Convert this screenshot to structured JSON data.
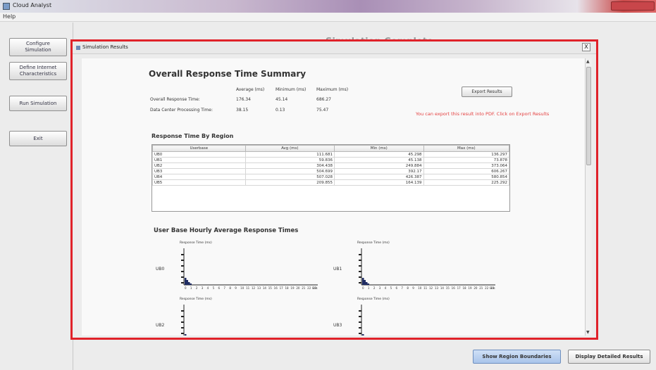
{
  "window": {
    "title": "Cloud Analyst"
  },
  "menu": {
    "help": "Help"
  },
  "nav": {
    "configure": "Configure\nSimulation",
    "internet": "Define Internet\nCharacteristics",
    "run": "Run Simulation",
    "exit": "Exit"
  },
  "main": {
    "title": "Simulation Complete"
  },
  "dialog": {
    "title": "Simulation Results",
    "close": "X",
    "overall": {
      "heading": "Overall Response Time Summary",
      "headers": {
        "avg": "Average (ms)",
        "min": "Minimum (ms)",
        "max": "Maximum (ms)"
      },
      "rows": [
        {
          "label": "Overall Response Time:",
          "avg": "176.34",
          "min": "45.14",
          "max": "686.27"
        },
        {
          "label": "Data Center Processing Time:",
          "avg": "38.15",
          "min": "0.13",
          "max": "75.47"
        }
      ]
    },
    "export_button": "Export Results",
    "export_note": "You can export this result into PDF. Click on Export Results",
    "region": {
      "heading": "Response Time By Region",
      "columns": [
        "Userbase",
        "Avg (ms)",
        "Min (ms)",
        "Max (ms)"
      ],
      "rows": [
        [
          "UB0",
          "111.681",
          "45.298",
          "136.297"
        ],
        [
          "UB1",
          "59.836",
          "45.138",
          "73.878"
        ],
        [
          "UB2",
          "304.438",
          "249.884",
          "373.064"
        ],
        [
          "UB3",
          "504.699",
          "392.17",
          "606.267"
        ],
        [
          "UB4",
          "507.028",
          "426.387",
          "580.854"
        ],
        [
          "UB5",
          "209.855",
          "164.139",
          "225.292"
        ]
      ]
    },
    "hourly": {
      "heading": "User Base Hourly Average Response Times",
      "y_label": "Response Time (ms)",
      "x_unit": "Hrs",
      "hours": [
        "0",
        "1",
        "2",
        "3",
        "4",
        "5",
        "6",
        "7",
        "8",
        "9",
        "10",
        "11",
        "12",
        "13",
        "14",
        "15",
        "16",
        "17",
        "18",
        "19",
        "20",
        "21",
        "22",
        "23"
      ],
      "charts": [
        {
          "ub": "UB0"
        },
        {
          "ub": "UB1"
        },
        {
          "ub": "UB2"
        },
        {
          "ub": "UB3"
        }
      ]
    }
  },
  "bottom": {
    "show_regions": "Show Region Boundaries",
    "detailed": "Display Detailed Results"
  },
  "colors": {
    "highlight": "#e0222a",
    "note": "#e44040",
    "bars": "#1f2c63"
  }
}
